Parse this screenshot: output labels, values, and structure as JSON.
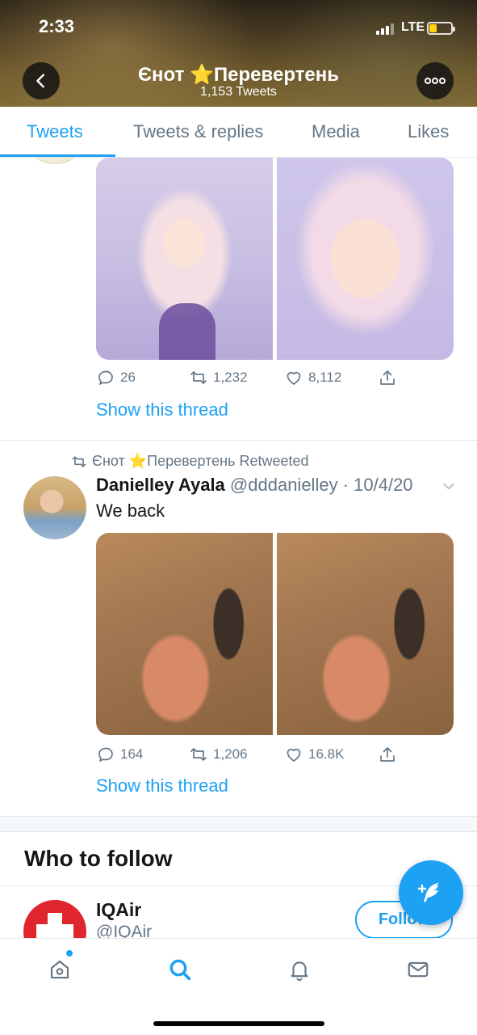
{
  "status_bar": {
    "time": "2:33",
    "network": "LTE",
    "battery_level": 0.35
  },
  "header": {
    "title": "Єнот ⭐Перевертень",
    "tweet_count": "1,153 Tweets",
    "back_icon": "chevron-left-icon",
    "more_icon": "more-icon"
  },
  "tabs": [
    {
      "label": "Tweets",
      "active": true
    },
    {
      "label": "Tweets & replies",
      "active": false
    },
    {
      "label": "Media",
      "active": false
    },
    {
      "label": "Likes",
      "active": false
    }
  ],
  "tweets": [
    {
      "media": [
        "anime elf girl illustration",
        "anime elf girl illustration close-up"
      ],
      "replies": "26",
      "retweets": "1,232",
      "likes": "8,112",
      "show_thread": "Show this thread"
    },
    {
      "retweeted_by": "Єнот ⭐Перевертень Retweeted",
      "author_name": "Danielley Ayala",
      "handle": "@dddanielley",
      "date": "· 10/4/20",
      "text": "We back",
      "media": [
        "shower photo",
        "shower photo"
      ],
      "replies": "164",
      "retweets": "1,206",
      "likes": "16.8K",
      "show_thread": "Show this thread"
    }
  ],
  "who_to_follow": {
    "title": "Who to follow",
    "accounts": [
      {
        "name": "IQAir",
        "handle": "@IQAir",
        "button": "Follow"
      }
    ]
  },
  "bottom_nav": [
    {
      "icon": "home-icon",
      "active": false,
      "has_badge": true
    },
    {
      "icon": "search-icon",
      "active": true
    },
    {
      "icon": "bell-icon",
      "active": false
    },
    {
      "icon": "mail-icon",
      "active": false
    }
  ],
  "colors": {
    "accent": "#1da1f2",
    "text": "#14171a",
    "muted": "#657786",
    "divider": "#e1e8ed"
  }
}
